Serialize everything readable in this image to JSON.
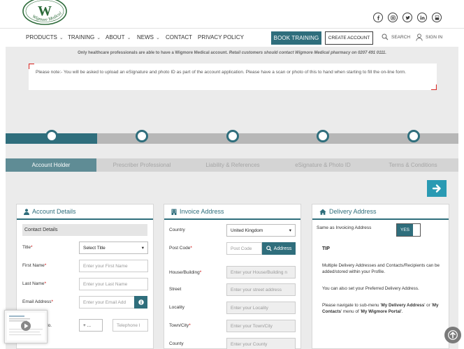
{
  "brand": {
    "name": "Wigmore Medical",
    "logo_letter": "W",
    "accent": "#2f6e7c",
    "progress_gray": "#b7b7b7"
  },
  "social": [
    "facebook-icon",
    "instagram-icon",
    "twitter-icon",
    "linkedin-icon",
    "youtube-icon"
  ],
  "nav": {
    "items": [
      {
        "label": "PRODUCTS",
        "dropdown": true
      },
      {
        "label": "TRAINING",
        "dropdown": true
      },
      {
        "label": "ABOUT",
        "dropdown": true
      },
      {
        "label": "NEWS",
        "dropdown": true
      },
      {
        "label": "CONTACT",
        "dropdown": false
      },
      {
        "label": "PRIVACY POLICY",
        "dropdown": false
      }
    ],
    "book_training": "BOOK TRAINING",
    "create_account": "CREATE ACCOUNT",
    "search": "SEARCH",
    "sign_in": "SIGN IN"
  },
  "notice": {
    "bold_text": "Only healthcare professionals are able to have a Wigmore Medical account.",
    "italic_text": "Retail customers should contact Wigmore Medical pharmacy on 0207 491 0111.",
    "box": "Please note:- You will be asked to upload an eSignature and photo ID as part of the account application. Please have a scan or photo of this to hand when starting to fill the on-line form."
  },
  "progress": {
    "current_step": 1,
    "total_steps": 5
  },
  "tabs": [
    "Account Holder",
    "Prescriber Professional",
    "Liability & References",
    "eSignature & Photo ID",
    "Terms & Conditions"
  ],
  "account": {
    "title": "Account Details",
    "section": "Contact Details",
    "title_label": "Title",
    "title_value": "Select Title",
    "first_name_label": "First Name",
    "first_name_ph": "Enter your First Name",
    "last_name_label": "Last Name",
    "last_name_ph": "Enter your Last Name",
    "email_label": "Email Address",
    "email_ph": "Enter your Email Add",
    "phone_label_partial": "No.",
    "phone_code": "+ ...",
    "phone_ph": "Telephone I"
  },
  "invoice": {
    "title": "Invoice Address",
    "country_label": "Country",
    "country_value": "United Kingdom",
    "postcode_label": "Post Code",
    "postcode_ph": "Post Code",
    "address_button": "Address",
    "house_label": "House/Building",
    "house_ph": "Enter your House/Building n",
    "street_label": "Street",
    "street_ph": "Enter your street address",
    "locality_label": "Locality",
    "locality_ph": "Enter your Locality",
    "town_label": "Town/City",
    "town_ph": "Enter your Town/City",
    "county_label": "County",
    "county_ph": "Enter your County"
  },
  "delivery": {
    "title": "Delivery Address",
    "same_label": "Same as Invoicing Address",
    "toggle": "YES",
    "tip_title": "TIP",
    "tip1": "Multiple Delivery Addresses and Contacts/Recipients can be added/stored within your Profile.",
    "tip2": "You can also set your Preferred Delivery Address.",
    "tip3_a": "Please navigate to sub-menu '",
    "tip3_b": "My Delivery Address",
    "tip3_c": "' or '",
    "tip3_d": "My Contacts",
    "tip3_e": "' menu of '",
    "tip3_f": "My Wigmore Portal",
    "tip3_g": "'."
  }
}
